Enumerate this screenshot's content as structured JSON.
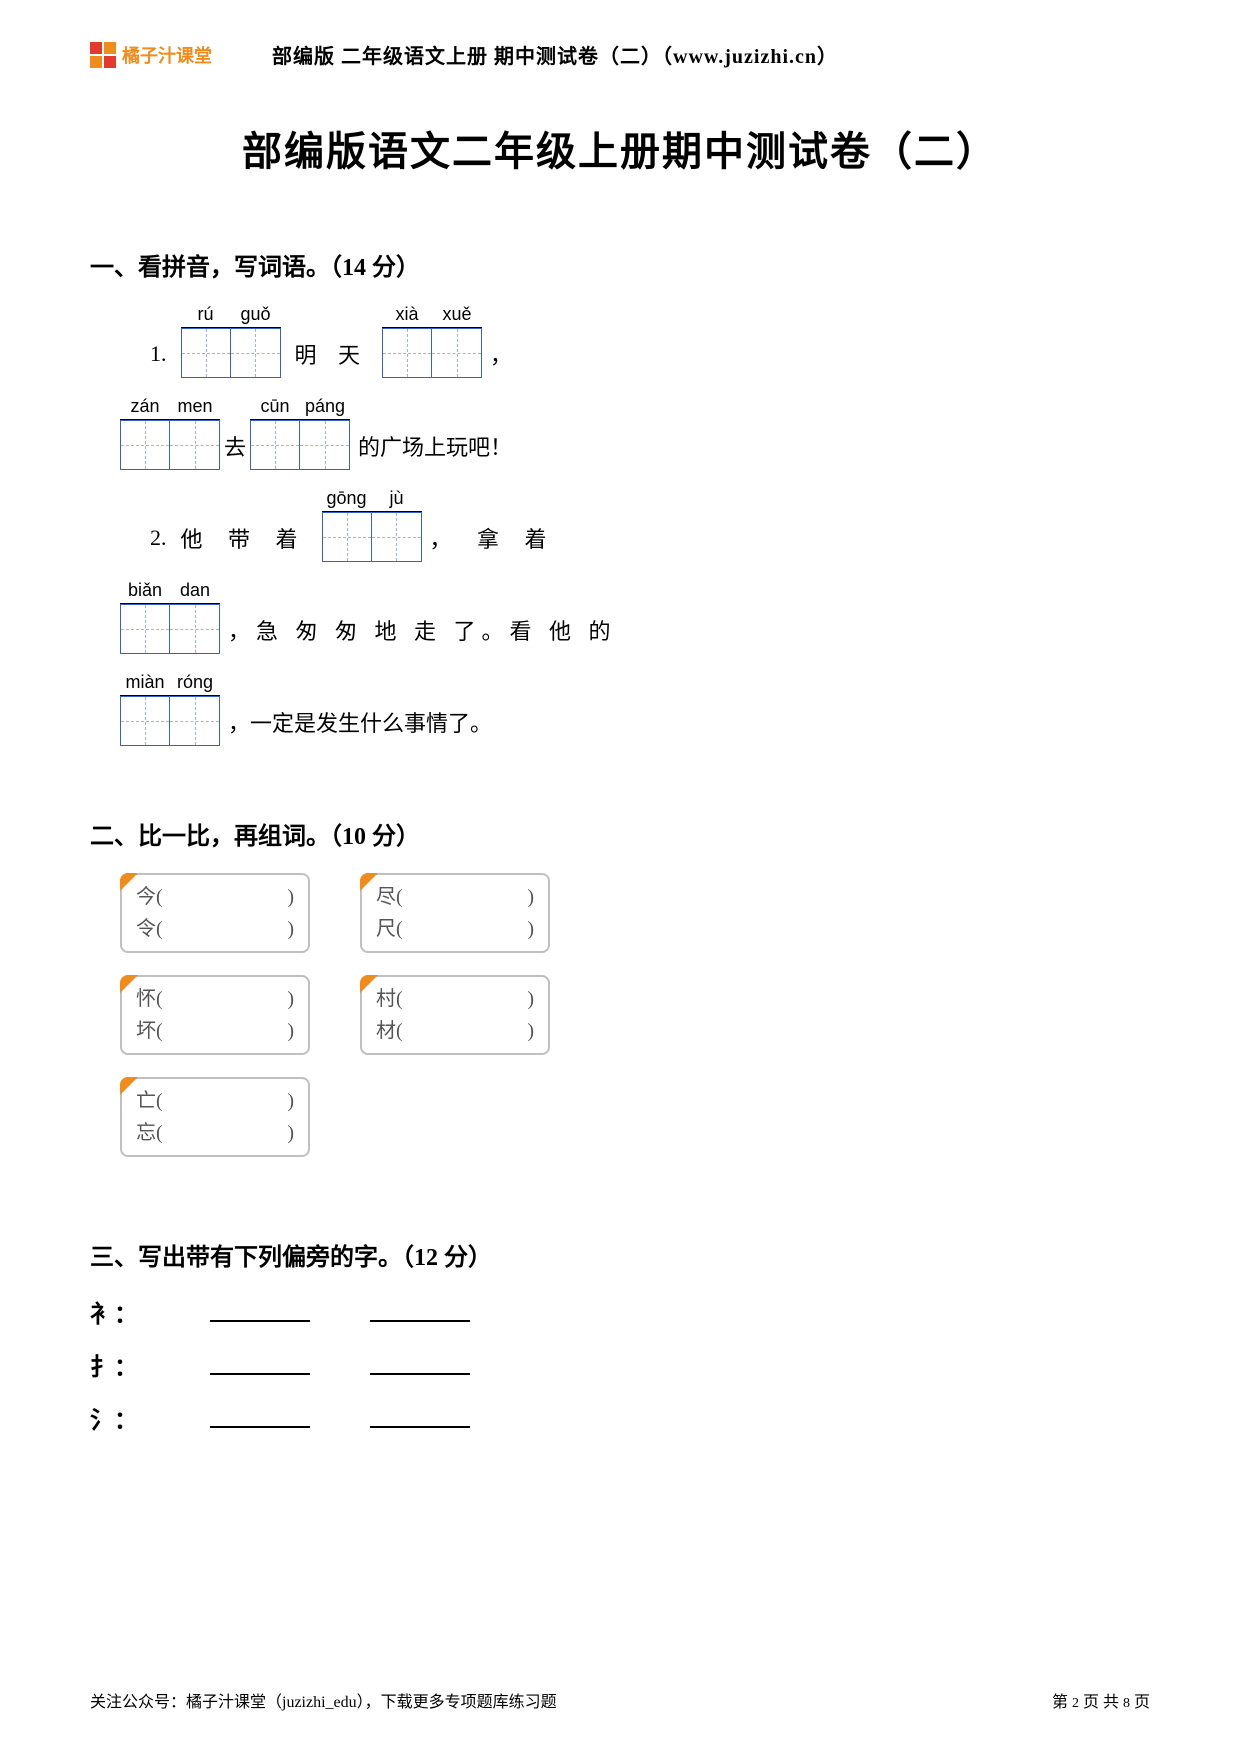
{
  "header": {
    "logo_text": "橘子汁课堂",
    "top_text": "部编版 二年级语文上册 期中测试卷（二）（www.juzizhi.cn）"
  },
  "title": "部编版语文二年级上册期中测试卷（二）",
  "sections": {
    "s1": {
      "heading": "一、看拼音，写词语。（14 分）",
      "line1": {
        "num": "1.",
        "p1a": "rú",
        "p1b": "guǒ",
        "mid1": "明 天",
        "p2a": "xià",
        "p2b": "xuě",
        "tail": "，"
      },
      "line2": {
        "p1a": "zán",
        "p1b": "men",
        "mid1": "去",
        "p2a": "cūn",
        "p2b": "páng",
        "tail": "的广场上玩吧！"
      },
      "line3": {
        "num": "2.",
        "pre": "他 带 着",
        "p1a": "gōng",
        "p1b": "jù",
        "tail": "， 拿 着"
      },
      "line4": {
        "p1a": "biǎn",
        "p1b": "dan",
        "tail": "，急 匆 匆 地 走 了。看 他 的"
      },
      "line5": {
        "p1a": "miàn",
        "p1b": "róng",
        "tail": "，一定是发生什么事情了。"
      }
    },
    "s2": {
      "heading": "二、比一比，再组词。（10 分）",
      "pairs": [
        {
          "a": "今(",
          "b": "令(",
          "c": ")",
          "d": ")"
        },
        {
          "a": "尽(",
          "b": "尺(",
          "c": ")",
          "d": ")"
        },
        {
          "a": "怀(",
          "b": "坏(",
          "c": ")",
          "d": ")"
        },
        {
          "a": "村(",
          "b": "材(",
          "c": ")",
          "d": ")"
        },
        {
          "a": "亡(",
          "b": "忘(",
          "c": ")",
          "d": ")"
        }
      ]
    },
    "s3": {
      "heading": "三、写出带有下列偏旁的字。（12 分）",
      "rows": [
        {
          "label": "衤："
        },
        {
          "label": "扌："
        },
        {
          "label": "氵："
        }
      ]
    }
  },
  "footer": {
    "left": "关注公众号：橘子汁课堂（juzizhi_edu），下载更多专项题库练习题",
    "right_a": "第 ",
    "right_b": "2",
    "right_c": " 页 共 ",
    "right_d": "8",
    "right_e": " 页"
  }
}
